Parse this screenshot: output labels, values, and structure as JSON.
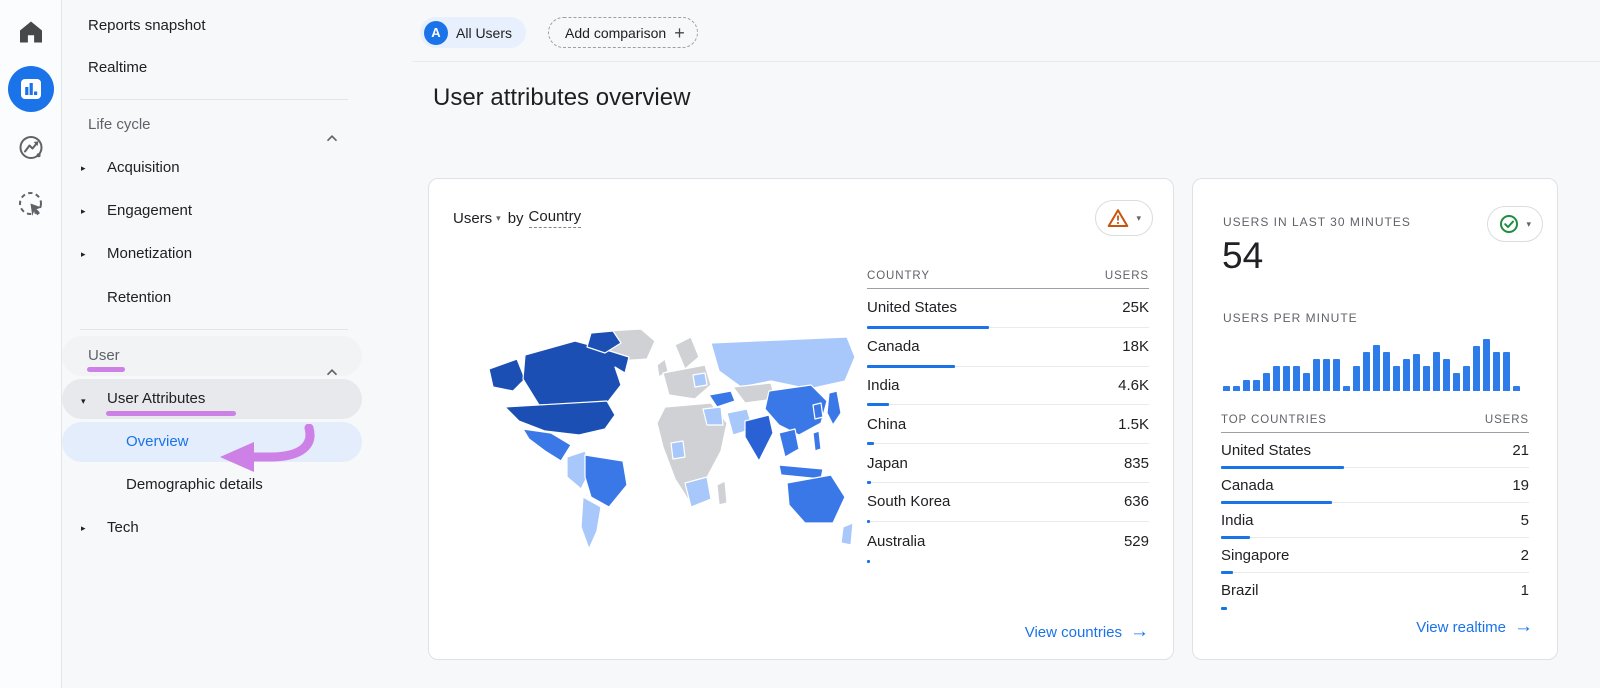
{
  "colors": {
    "accent": "#1a73e8",
    "annotation": "#cd80e6",
    "warning": "#c9540e",
    "success": "#1e8e3e",
    "map": {
      "dark": "#1b4fb3",
      "medium": "#3b78e7",
      "strong": "#2a62d6",
      "light": "#a8c7fa",
      "none": "#cfd1d4"
    }
  },
  "topbar": {
    "all_users_chip": {
      "avatar": "A",
      "label": "All Users"
    },
    "add_comparison": {
      "label": "Add comparison",
      "plus": "+"
    }
  },
  "page": {
    "title": "User attributes overview"
  },
  "sidebar": {
    "reports_snapshot": "Reports snapshot",
    "realtime": "Realtime",
    "life_cycle_header": "Life cycle",
    "acquisition": "Acquisition",
    "engagement": "Engagement",
    "monetization": "Monetization",
    "retention": "Retention",
    "user_header": "User",
    "user_attributes": "User Attributes",
    "overview": "Overview",
    "demographic_details": "Demographic details",
    "tech": "Tech"
  },
  "main_card": {
    "metric_selector": "Users",
    "by_label": "by",
    "dimension_selector": "Country",
    "table": {
      "col_country": "COUNTRY",
      "col_users": "USERS",
      "rows": [
        {
          "country": "United States",
          "users": "25K",
          "users_num": 25000
        },
        {
          "country": "Canada",
          "users": "18K",
          "users_num": 18000
        },
        {
          "country": "India",
          "users": "4.6K",
          "users_num": 4600
        },
        {
          "country": "China",
          "users": "1.5K",
          "users_num": 1500
        },
        {
          "country": "Japan",
          "users": "835",
          "users_num": 835
        },
        {
          "country": "South Korea",
          "users": "636",
          "users_num": 636
        },
        {
          "country": "Australia",
          "users": "529",
          "users_num": 529
        }
      ]
    },
    "footer_link": "View countries"
  },
  "realtime_card": {
    "last30_label": "USERS IN LAST 30 MINUTES",
    "last30_value": "54",
    "per_minute_label": "USERS PER MINUTE",
    "chart": {
      "type": "bar",
      "bars": [
        5,
        5,
        11,
        11,
        18,
        25,
        25,
        25,
        18,
        32,
        32,
        32,
        5,
        25,
        39,
        46,
        39,
        25,
        32,
        37,
        25,
        39,
        32,
        18,
        25,
        45,
        52,
        39,
        39,
        5
      ]
    },
    "table": {
      "col_country": "TOP COUNTRIES",
      "col_users": "USERS",
      "rows": [
        {
          "country": "United States",
          "users": "21",
          "users_num": 21
        },
        {
          "country": "Canada",
          "users": "19",
          "users_num": 19
        },
        {
          "country": "India",
          "users": "5",
          "users_num": 5
        },
        {
          "country": "Singapore",
          "users": "2",
          "users_num": 2
        },
        {
          "country": "Brazil",
          "users": "1",
          "users_num": 1
        }
      ]
    },
    "footer_link": "View realtime"
  }
}
